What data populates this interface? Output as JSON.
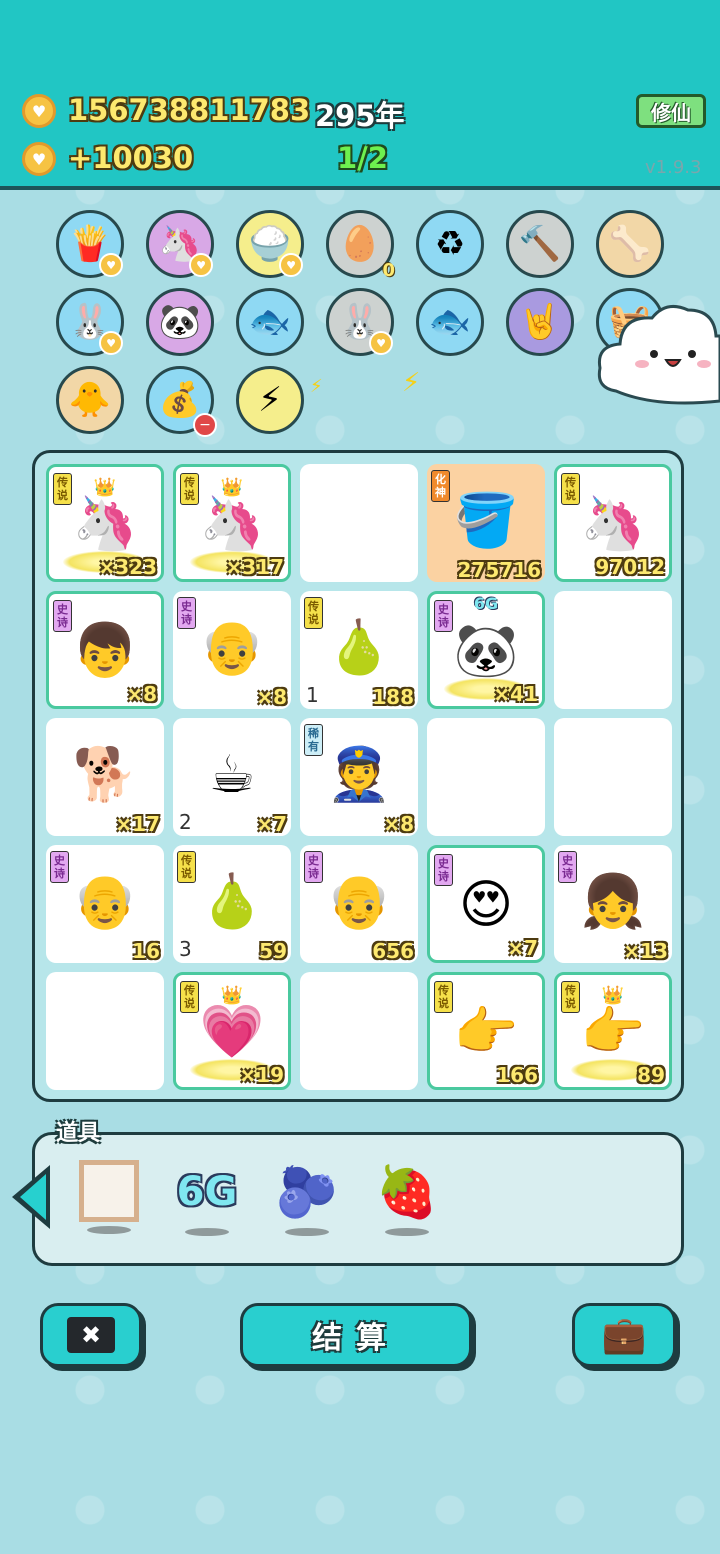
{
  "header": {
    "coins": "156738811783",
    "years": "295年",
    "income": "+10030",
    "progress": "1/2",
    "xiuxian_label": "修仙",
    "version": "v1.9.3"
  },
  "circle_row3": {
    "battery_count": "0"
  },
  "grid": {
    "r0c0": {
      "tag": "传说",
      "count": "×323"
    },
    "r0c1": {
      "tag": "传说",
      "count": "×317"
    },
    "r0c3": {
      "tag": "化神",
      "count": "275716"
    },
    "r0c4": {
      "tag": "传说",
      "count": "97012"
    },
    "r1c0": {
      "tag": "史诗",
      "count": "×8"
    },
    "r1c1": {
      "tag": "史诗",
      "count": "×8"
    },
    "r1c2": {
      "tag": "传说",
      "level": "1",
      "count": "188"
    },
    "r1c3": {
      "tag": "史诗",
      "badge": "6G",
      "count": "×41"
    },
    "r2c0": {
      "count": "×17"
    },
    "r2c1": {
      "level": "2",
      "count": "×7"
    },
    "r2c2": {
      "tag": "稀有",
      "count": "×8"
    },
    "r3c0": {
      "tag": "史诗",
      "count": "16"
    },
    "r3c1": {
      "tag": "传说",
      "level": "3",
      "count": "59"
    },
    "r3c2": {
      "tag": "史诗",
      "count": "656"
    },
    "r3c3": {
      "tag": "史诗",
      "count": "×7"
    },
    "r3c4": {
      "tag": "史诗",
      "count": "×13"
    },
    "r4c1": {
      "tag": "传说",
      "count": "×19"
    },
    "r4c3": {
      "tag": "传说",
      "count": "166"
    },
    "r4c4": {
      "tag": "传说",
      "count": "89"
    }
  },
  "props": {
    "label": "道具",
    "items": [
      "frame",
      "6G",
      "bayberry",
      "strawberry"
    ],
    "sixg_text": "6G"
  },
  "buttons": {
    "settle": "结算"
  }
}
